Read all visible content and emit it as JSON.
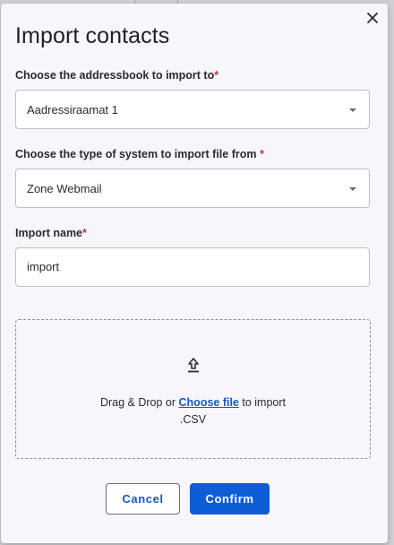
{
  "dialog": {
    "title": "Import contacts",
    "close_icon": "close-icon"
  },
  "addressbook": {
    "label": "Choose the addressbook to import to",
    "required_mark": "*",
    "selected": "Aadressiraamat 1"
  },
  "system": {
    "label": "Choose the type of system to import file from ",
    "required_mark": "*",
    "selected": "Zone Webmail"
  },
  "import_name": {
    "label": "Import name",
    "required_mark": "*",
    "value": "import"
  },
  "dropzone": {
    "icon": "upload-icon",
    "text_before": "Drag & Drop or ",
    "link_label": "Choose file",
    "text_after": " to import",
    "extension": ".CSV"
  },
  "actions": {
    "cancel_label": "Cancel",
    "confirm_label": "Confirm"
  },
  "colors": {
    "primary": "#0d5ed6",
    "link": "#1a56c4",
    "required": "#d32f2f"
  }
}
